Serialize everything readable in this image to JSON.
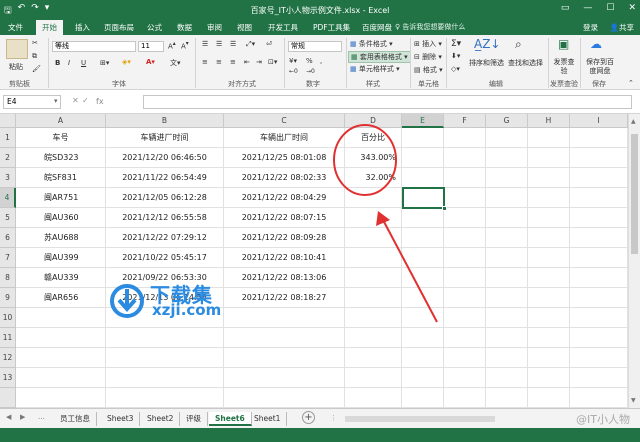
{
  "window": {
    "title": "百家号_IT小人物示例文件.xlsx - Excel",
    "controls": [
      "▭",
      "—",
      "☐",
      "✕"
    ]
  },
  "tabs": [
    "文件",
    "开始",
    "插入",
    "页面布局",
    "公式",
    "数据",
    "审阅",
    "视图",
    "开发工具",
    "PDF工具集",
    "百度网盘"
  ],
  "tell_me": "告诉我您想要做什么",
  "login": "登录",
  "share": "共享",
  "ribbon": {
    "clipboard": {
      "label": "剪贴板",
      "paste": "粘贴"
    },
    "font": {
      "label": "字体",
      "name": "等线",
      "size": "11",
      "bold": "B",
      "italic": "I",
      "underline": "U"
    },
    "alignment": {
      "label": "对齐方式"
    },
    "number": {
      "label": "数字",
      "format": "常规",
      "pct": "%",
      "comma": ","
    },
    "styles": {
      "label": "样式",
      "cond": "条件格式",
      "table": "套用表格格式",
      "cell": "单元格样式"
    },
    "cells": {
      "label": "单元格",
      "insert": "插入",
      "delete": "删除",
      "format": "格式"
    },
    "edit": {
      "label": "编辑",
      "sort": "排序和筛选",
      "find": "查找和选择"
    },
    "save": {
      "label": "保存",
      "check": "发票查验",
      "checkgroup": "发票查验",
      "baidu": "保存到百度网盘"
    }
  },
  "namebox": "E4",
  "fx": "fx",
  "columns": [
    "A",
    "B",
    "C",
    "D",
    "E",
    "F",
    "G",
    "H",
    "I"
  ],
  "rows": [
    "1",
    "2",
    "3",
    "4",
    "5",
    "6",
    "7",
    "8",
    "9",
    "10",
    "11",
    "12",
    "13"
  ],
  "table": {
    "header": [
      "车号",
      "车辆进厂时间",
      "车辆出厂时间",
      "百分比"
    ],
    "data": [
      [
        "皖SD323",
        "2021/12/20 06:46:50",
        "2021/12/25 08:01:08",
        "343.00%"
      ],
      [
        "皖SF831",
        "2021/11/22 06:54:49",
        "2021/12/22 08:02:33",
        "32.00%"
      ],
      [
        "闽AR751",
        "2021/12/05 06:12:28",
        "2021/12/22 08:04:29",
        ""
      ],
      [
        "闽AU360",
        "2021/12/12 06:55:58",
        "2021/12/22 08:07:15",
        ""
      ],
      [
        "苏AU688",
        "2021/12/22 07:29:12",
        "2021/12/22 08:09:28",
        ""
      ],
      [
        "闽AU399",
        "2021/10/22 05:45:17",
        "2021/12/22 08:10:41",
        ""
      ],
      [
        "赣AU339",
        "2021/09/22 06:53:30",
        "2021/12/22 08:13:06",
        ""
      ],
      [
        "闽AR656",
        "2021/12/13 06:14:56",
        "2021/12/22 08:18:27",
        ""
      ]
    ]
  },
  "sheets": [
    "员工信息",
    "Sheet3",
    "Sheet2",
    "评级",
    "Sheet6",
    "Sheet1"
  ],
  "active_sheet": "Sheet6",
  "add_sheet": "+",
  "watermark": {
    "cn": "下载集",
    "en": "xzji.com"
  },
  "corner_mark": "@IT小人物",
  "colors": {
    "excel_green": "#217346",
    "annotation_red": "#e03030",
    "watermark_blue": "#2a8be0"
  }
}
